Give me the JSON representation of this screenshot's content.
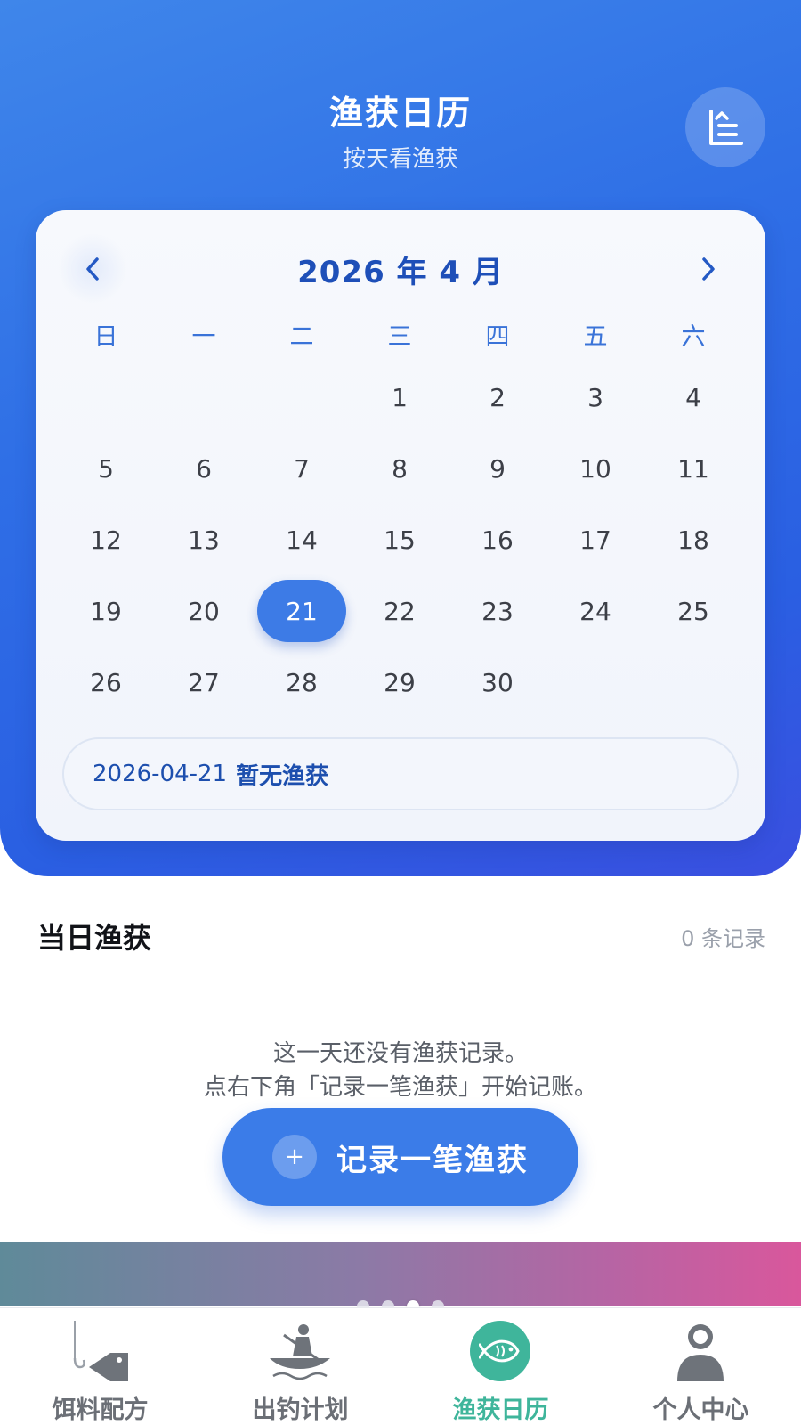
{
  "header": {
    "title": "渔获日历",
    "subtitle": "按天看渔获",
    "stats_icon": "stats-list-icon"
  },
  "calendar": {
    "month_label": "2026 年 4 月",
    "prev_icon": "chevron-left-icon",
    "next_icon": "chevron-right-icon",
    "weekdays": [
      "日",
      "一",
      "二",
      "三",
      "四",
      "五",
      "六"
    ],
    "weeks": [
      [
        "",
        "",
        "",
        "1",
        "2",
        "3",
        "4"
      ],
      [
        "5",
        "6",
        "7",
        "8",
        "9",
        "10",
        "11"
      ],
      [
        "12",
        "13",
        "14",
        "15",
        "16",
        "17",
        "18"
      ],
      [
        "19",
        "20",
        "21",
        "22",
        "23",
        "24",
        "25"
      ],
      [
        "26",
        "27",
        "28",
        "29",
        "30",
        "",
        ""
      ]
    ],
    "selected_day": "21",
    "selected_date": "2026-04-21",
    "selected_status": "暂无渔获"
  },
  "day_section": {
    "title": "当日渔获",
    "count": "0 条记录",
    "empty_line1": "这一天还没有渔获记录。",
    "empty_line2": "点右下角「记录一笔渔获」开始记账。",
    "add_button_label": "记录一笔渔获",
    "add_icon": "plus-icon"
  },
  "banner": {
    "dots_count": 4,
    "active_dot": 3
  },
  "tabbar": {
    "tabs": [
      {
        "label": "饵料配方",
        "icon": "hook-fish-icon"
      },
      {
        "label": "出钓计划",
        "icon": "kayak-icon"
      },
      {
        "label": "渔获日历",
        "icon": "fish-icon"
      },
      {
        "label": "个人中心",
        "icon": "person-icon"
      }
    ],
    "active_index": 2,
    "active_color": "#3fb59b"
  },
  "colors": {
    "primary": "#3d7be6",
    "hero_gradient_start": "#3f86ea",
    "hero_gradient_end": "#3a4fe0",
    "accent_green": "#3fb59b"
  }
}
